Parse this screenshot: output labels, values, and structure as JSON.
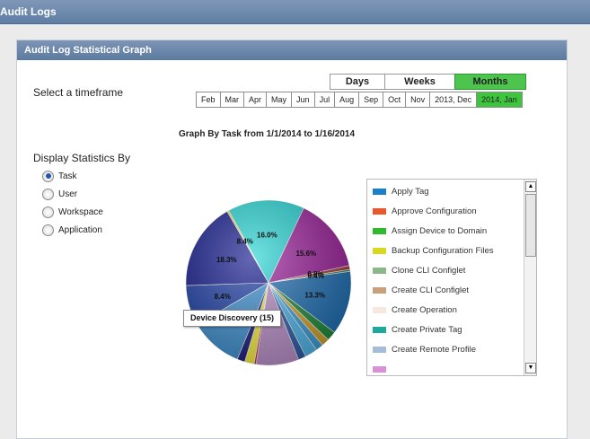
{
  "page_title": "Audit Logs",
  "panel_title": "Audit Log Statistical Graph",
  "timeframe_label": "Select a timeframe",
  "range_buttons": [
    "Days",
    "Weeks",
    "Months"
  ],
  "active_range": "Months",
  "months": [
    "Feb",
    "Mar",
    "Apr",
    "May",
    "Jun",
    "Jul",
    "Aug",
    "Sep",
    "Oct",
    "Nov",
    "2013, Dec",
    "2014, Jan"
  ],
  "active_month": "2014, Jan",
  "graph_title": "Graph By Task from 1/1/2014 to 1/16/2014",
  "display_label": "Display Statistics By",
  "display_options": [
    {
      "label": "Task",
      "checked": true
    },
    {
      "label": "User",
      "checked": false
    },
    {
      "label": "Workspace",
      "checked": false
    },
    {
      "label": "Application",
      "checked": false
    }
  ],
  "tooltip": "Device Discovery (15)",
  "legend_items": [
    {
      "label": "Apply Tag",
      "color": "#1b80c8"
    },
    {
      "label": "Approve Configuration",
      "color": "#e8582a"
    },
    {
      "label": "Assign Device to Domain",
      "color": "#2dbb2d"
    },
    {
      "label": "Backup Configuration Files",
      "color": "#d8d820"
    },
    {
      "label": "Clone CLI Configlet",
      "color": "#8ab88a"
    },
    {
      "label": "Create CLI Configlet",
      "color": "#c8a07c"
    },
    {
      "label": "Create Operation",
      "color": "#f6e8e0"
    },
    {
      "label": "Create Private Tag",
      "color": "#1fa89c"
    },
    {
      "label": "Create Remote Profile",
      "color": "#a6bcd8"
    }
  ],
  "chart_data": {
    "type": "pie",
    "title": "Graph By Task from 1/1/2014 to 1/16/2014",
    "slices": [
      {
        "label": "Device Discovery",
        "value": 13.3,
        "color": "#1f6fb4",
        "text": "13.3%"
      },
      {
        "label": "",
        "value": 2.0,
        "color": "#1e8a3a",
        "text": ""
      },
      {
        "label": "",
        "value": 1.6,
        "color": "#d3a12e",
        "text": ""
      },
      {
        "label": "",
        "value": 1.6,
        "color": "#3d9cd6",
        "text": ""
      },
      {
        "label": "",
        "value": 2.6,
        "color": "#4fb6ea",
        "text": ""
      },
      {
        "label": "",
        "value": 1.6,
        "color": "#2e5aa6",
        "text": ""
      },
      {
        "label": "",
        "value": 8.9,
        "color": "#b88fc8",
        "text": ""
      },
      {
        "label": "",
        "value": 0.4,
        "color": "#cc2222",
        "text": ""
      },
      {
        "label": "",
        "value": 2.0,
        "color": "#f2ee40",
        "text": ""
      },
      {
        "label": "",
        "value": 1.6,
        "color": "#1b1b80",
        "text": ""
      },
      {
        "label": "",
        "value": 11.1,
        "color": "#3d8fcf",
        "text": "11.1%"
      },
      {
        "label": "",
        "value": 8.4,
        "color": "#1c3ea6",
        "text": "8.4%"
      },
      {
        "label": "",
        "value": 18.3,
        "color": "#12188c",
        "text": "18.3%"
      },
      {
        "label": "",
        "value": 0.4,
        "color": "#f4d028",
        "text": "8.4%"
      },
      {
        "label": "",
        "value": 16.0,
        "color": "#26d4d4",
        "text": "16.0%"
      },
      {
        "label": "",
        "value": 15.6,
        "color": "#9a1f9a",
        "text": "15.6%"
      },
      {
        "label": "",
        "value": 0.8,
        "color": "#a83838",
        "text": "0.8%"
      },
      {
        "label": "",
        "value": 0.4,
        "color": "#3a8a4a",
        "text": "0.4%"
      }
    ]
  }
}
